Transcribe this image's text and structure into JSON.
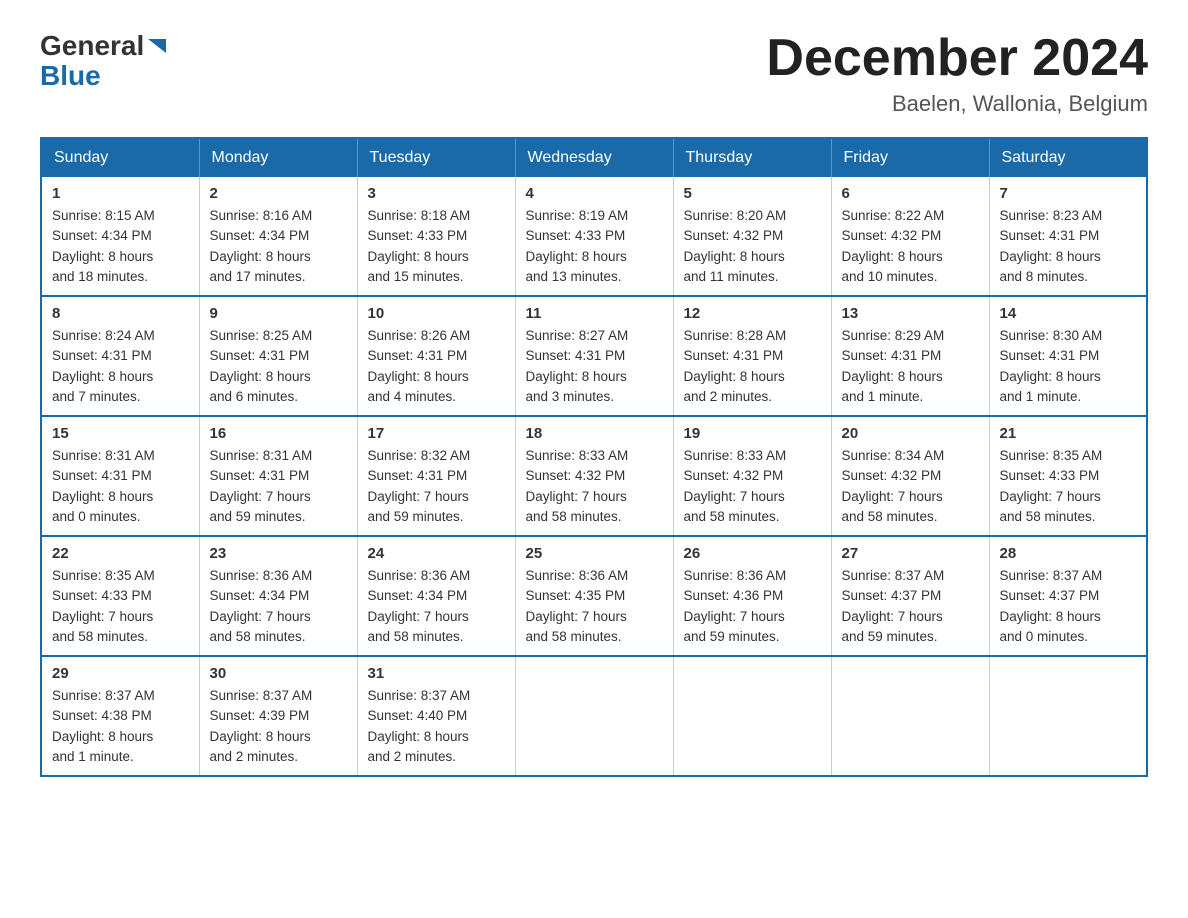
{
  "header": {
    "logo_general": "General",
    "logo_blue": "Blue",
    "month_title": "December 2024",
    "location": "Baelen, Wallonia, Belgium"
  },
  "weekdays": [
    "Sunday",
    "Monday",
    "Tuesday",
    "Wednesday",
    "Thursday",
    "Friday",
    "Saturday"
  ],
  "weeks": [
    [
      {
        "day": "1",
        "sunrise": "8:15 AM",
        "sunset": "4:34 PM",
        "daylight": "8 hours and 18 minutes."
      },
      {
        "day": "2",
        "sunrise": "8:16 AM",
        "sunset": "4:34 PM",
        "daylight": "8 hours and 17 minutes."
      },
      {
        "day": "3",
        "sunrise": "8:18 AM",
        "sunset": "4:33 PM",
        "daylight": "8 hours and 15 minutes."
      },
      {
        "day": "4",
        "sunrise": "8:19 AM",
        "sunset": "4:33 PM",
        "daylight": "8 hours and 13 minutes."
      },
      {
        "day": "5",
        "sunrise": "8:20 AM",
        "sunset": "4:32 PM",
        "daylight": "8 hours and 11 minutes."
      },
      {
        "day": "6",
        "sunrise": "8:22 AM",
        "sunset": "4:32 PM",
        "daylight": "8 hours and 10 minutes."
      },
      {
        "day": "7",
        "sunrise": "8:23 AM",
        "sunset": "4:31 PM",
        "daylight": "8 hours and 8 minutes."
      }
    ],
    [
      {
        "day": "8",
        "sunrise": "8:24 AM",
        "sunset": "4:31 PM",
        "daylight": "8 hours and 7 minutes."
      },
      {
        "day": "9",
        "sunrise": "8:25 AM",
        "sunset": "4:31 PM",
        "daylight": "8 hours and 6 minutes."
      },
      {
        "day": "10",
        "sunrise": "8:26 AM",
        "sunset": "4:31 PM",
        "daylight": "8 hours and 4 minutes."
      },
      {
        "day": "11",
        "sunrise": "8:27 AM",
        "sunset": "4:31 PM",
        "daylight": "8 hours and 3 minutes."
      },
      {
        "day": "12",
        "sunrise": "8:28 AM",
        "sunset": "4:31 PM",
        "daylight": "8 hours and 2 minutes."
      },
      {
        "day": "13",
        "sunrise": "8:29 AM",
        "sunset": "4:31 PM",
        "daylight": "8 hours and 1 minute."
      },
      {
        "day": "14",
        "sunrise": "8:30 AM",
        "sunset": "4:31 PM",
        "daylight": "8 hours and 1 minute."
      }
    ],
    [
      {
        "day": "15",
        "sunrise": "8:31 AM",
        "sunset": "4:31 PM",
        "daylight": "8 hours and 0 minutes."
      },
      {
        "day": "16",
        "sunrise": "8:31 AM",
        "sunset": "4:31 PM",
        "daylight": "7 hours and 59 minutes."
      },
      {
        "day": "17",
        "sunrise": "8:32 AM",
        "sunset": "4:31 PM",
        "daylight": "7 hours and 59 minutes."
      },
      {
        "day": "18",
        "sunrise": "8:33 AM",
        "sunset": "4:32 PM",
        "daylight": "7 hours and 58 minutes."
      },
      {
        "day": "19",
        "sunrise": "8:33 AM",
        "sunset": "4:32 PM",
        "daylight": "7 hours and 58 minutes."
      },
      {
        "day": "20",
        "sunrise": "8:34 AM",
        "sunset": "4:32 PM",
        "daylight": "7 hours and 58 minutes."
      },
      {
        "day": "21",
        "sunrise": "8:35 AM",
        "sunset": "4:33 PM",
        "daylight": "7 hours and 58 minutes."
      }
    ],
    [
      {
        "day": "22",
        "sunrise": "8:35 AM",
        "sunset": "4:33 PM",
        "daylight": "7 hours and 58 minutes."
      },
      {
        "day": "23",
        "sunrise": "8:36 AM",
        "sunset": "4:34 PM",
        "daylight": "7 hours and 58 minutes."
      },
      {
        "day": "24",
        "sunrise": "8:36 AM",
        "sunset": "4:34 PM",
        "daylight": "7 hours and 58 minutes."
      },
      {
        "day": "25",
        "sunrise": "8:36 AM",
        "sunset": "4:35 PM",
        "daylight": "7 hours and 58 minutes."
      },
      {
        "day": "26",
        "sunrise": "8:36 AM",
        "sunset": "4:36 PM",
        "daylight": "7 hours and 59 minutes."
      },
      {
        "day": "27",
        "sunrise": "8:37 AM",
        "sunset": "4:37 PM",
        "daylight": "7 hours and 59 minutes."
      },
      {
        "day": "28",
        "sunrise": "8:37 AM",
        "sunset": "4:37 PM",
        "daylight": "8 hours and 0 minutes."
      }
    ],
    [
      {
        "day": "29",
        "sunrise": "8:37 AM",
        "sunset": "4:38 PM",
        "daylight": "8 hours and 1 minute."
      },
      {
        "day": "30",
        "sunrise": "8:37 AM",
        "sunset": "4:39 PM",
        "daylight": "8 hours and 2 minutes."
      },
      {
        "day": "31",
        "sunrise": "8:37 AM",
        "sunset": "4:40 PM",
        "daylight": "8 hours and 2 minutes."
      },
      null,
      null,
      null,
      null
    ]
  ],
  "labels": {
    "sunrise": "Sunrise:",
    "sunset": "Sunset:",
    "daylight": "Daylight:"
  }
}
